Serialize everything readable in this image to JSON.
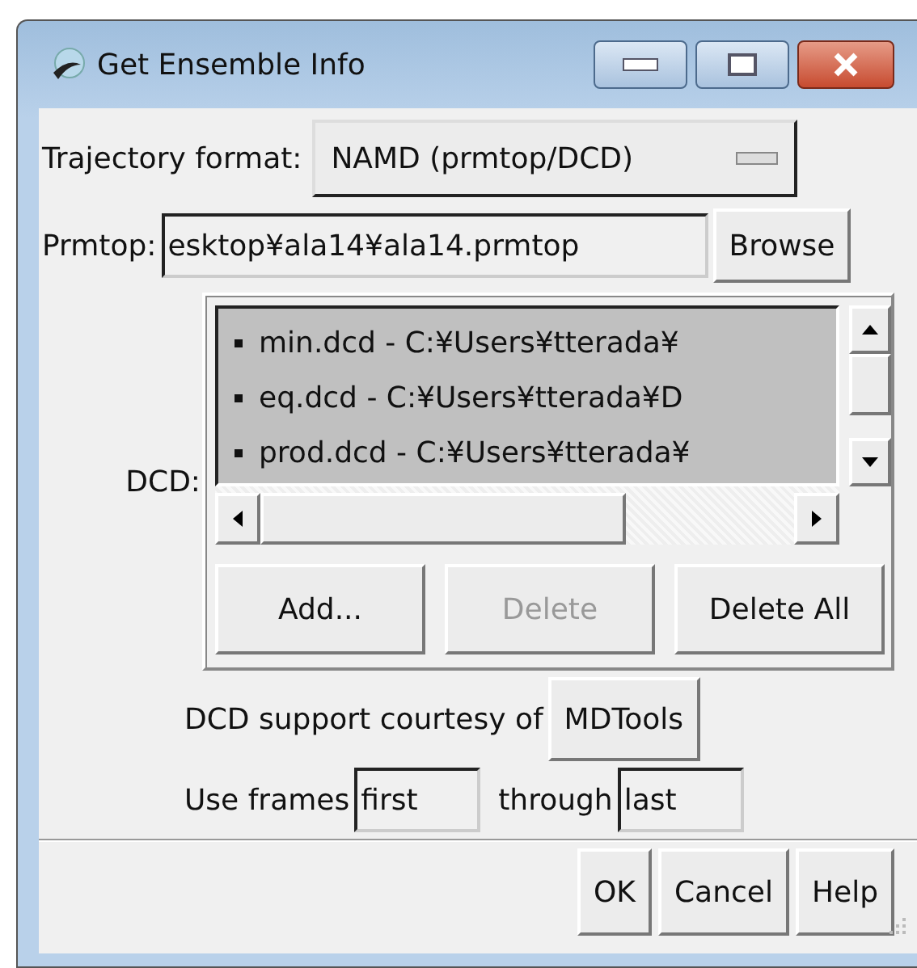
{
  "window": {
    "title": "Get Ensemble Info"
  },
  "trajectory_format": {
    "label": "Trajectory format:",
    "value": "NAMD (prmtop/DCD)"
  },
  "prmtop": {
    "label": "Prmtop:",
    "value": "esktop¥ala14¥ala14.prmtop",
    "button": "Browse"
  },
  "dcd": {
    "label": "DCD:",
    "files": [
      {
        "text": "min.dcd - C:¥Users¥tterada¥"
      },
      {
        "text": "eq.dcd - C:¥Users¥tterada¥D"
      },
      {
        "text": "prod.dcd - C:¥Users¥tterada¥"
      }
    ],
    "buttons": [
      {
        "label": "Add...",
        "disabled": false
      },
      {
        "label": "Delete",
        "disabled": true
      },
      {
        "label": "Delete All",
        "disabled": false
      }
    ]
  },
  "support": {
    "text": "DCD support courtesy of",
    "button": "MDTools"
  },
  "frames": {
    "label": "Use frames",
    "first": "first",
    "through": "through",
    "last": "last"
  },
  "buttons": [
    "OK",
    "Cancel",
    "Help"
  ]
}
